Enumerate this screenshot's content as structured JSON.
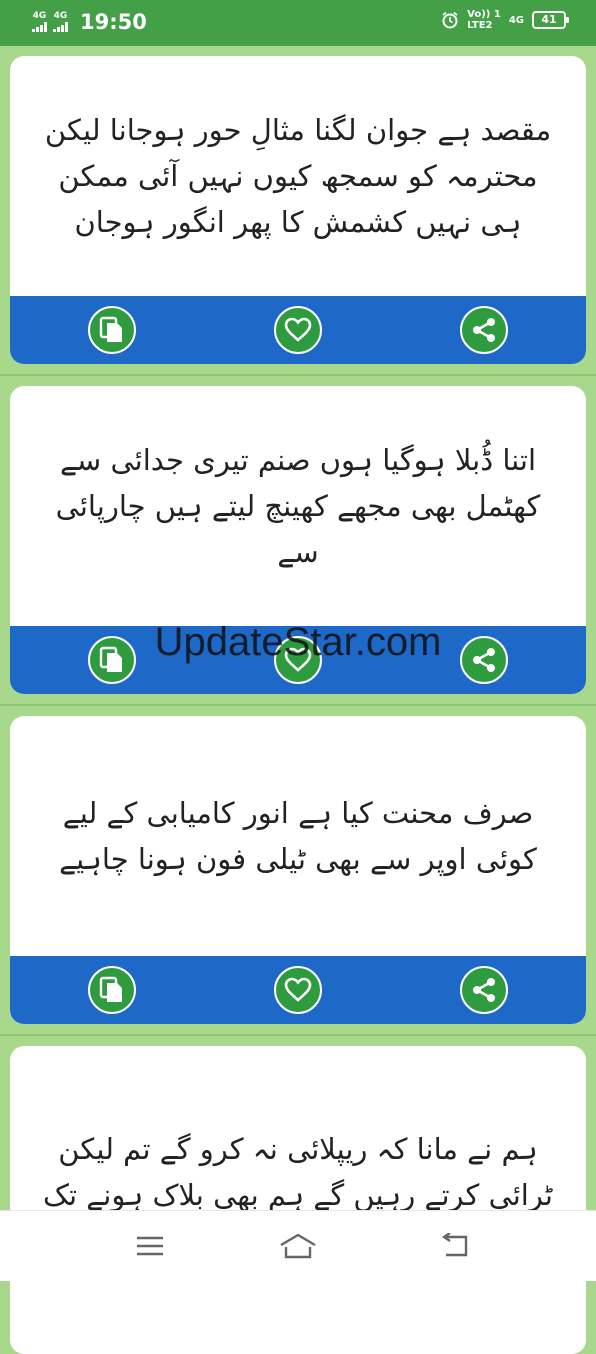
{
  "status_bar": {
    "network1": "4G",
    "network2": "4G",
    "time": "19:50",
    "volte_top": "Vo)) 1",
    "volte_bottom": "LTE2",
    "network3": "4G",
    "battery": "41"
  },
  "cards": [
    {
      "text": "مقصد ہے جوان لگنا مثالِ حور ہوجانا لیکن محترمہ کو سمجھ کیوں نہیں آئی ممکن ہی نہیں کشمش کا پھر انگور ہوجان"
    },
    {
      "text": "اتنا ڈُبلا ہوگیا ہوں صنم تیری جدائی سے کھٹمل بھی مجھے کھینچ لیتے ہیں چارپائی سے"
    },
    {
      "text": "صرف محنت کیا ہے انور کامیابی کے لیے کوئی اوپر سے بھی ٹیلی فون ہونا چاہیے"
    },
    {
      "text": "ہم نے مانا کہ ریپلائی نہ کرو گے تم لیکن ٹرائی کرتے رہیں گے ہم بھی بلاک ہونے تک"
    }
  ],
  "watermark": "UpdateStar.com",
  "icons": {
    "copy": "copy-icon",
    "favorite": "heart-icon",
    "share": "share-icon",
    "menu": "menu-icon",
    "home": "home-icon",
    "back": "back-icon"
  },
  "colors": {
    "status_bar": "#43a047",
    "background": "#a8d88c",
    "action_bar": "#1e68c8",
    "action_button": "#2e9b3e"
  }
}
